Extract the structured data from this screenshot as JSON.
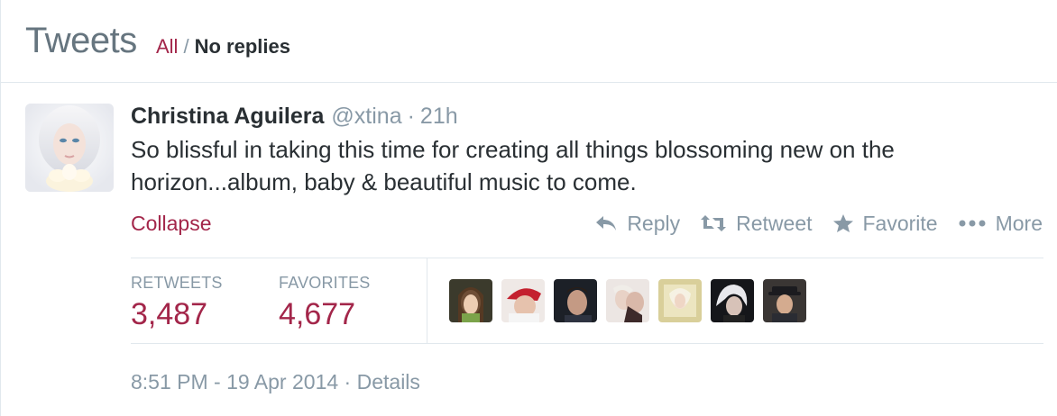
{
  "header": {
    "title": "Tweets",
    "filter_all": "All",
    "filter_separator": "/",
    "filter_noreplies": "No replies"
  },
  "tweet": {
    "fullname": "Christina Aguilera",
    "username": "@xtina",
    "separator": "·",
    "time": "21h",
    "text": "So blissful in taking this time for creating all things blossoming new on the horizon...album, baby & beautiful music to come.",
    "collapse_label": "Collapse",
    "actions": {
      "reply": "Reply",
      "retweet": "Retweet",
      "favorite": "Favorite",
      "more": "More"
    },
    "stats": {
      "retweets_label": "RETWEETS",
      "retweets_value": "3,487",
      "favorites_label": "FAVORITES",
      "favorites_value": "4,677"
    },
    "favoriter_avatars": [
      "user-avatar-1",
      "user-avatar-2",
      "user-avatar-3",
      "user-avatar-4",
      "user-avatar-5",
      "user-avatar-6",
      "user-avatar-7"
    ],
    "footer": {
      "timestamp": "8:51 PM - 19 Apr 2014",
      "separator": "·",
      "details": "Details"
    }
  },
  "colors": {
    "accent": "#a3264a",
    "muted": "#8899a6",
    "text": "#292f33",
    "border": "#e1e8ed"
  }
}
